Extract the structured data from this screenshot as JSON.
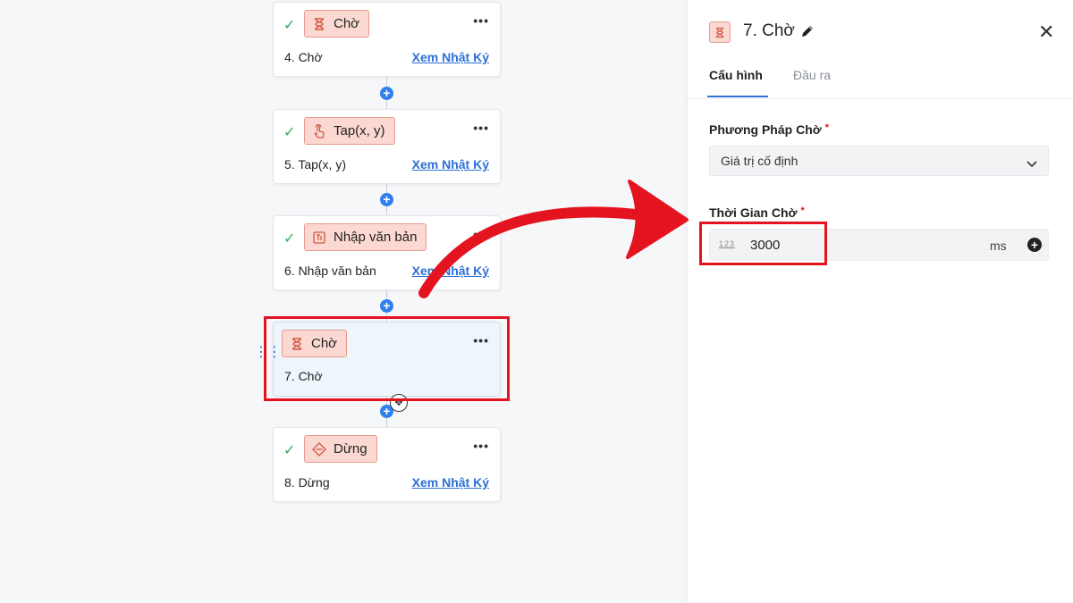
{
  "workflow": {
    "cards": [
      {
        "pill_label": "Chờ",
        "icon": "hourglass-icon",
        "step_label": "4. Chờ",
        "log_link": "Xem Nhật Ký",
        "completed": true
      },
      {
        "pill_label": "Tap(x, y)",
        "icon": "tap-hand-icon",
        "step_label": "5. Tap(x, y)",
        "log_link": "Xem Nhật Ký",
        "completed": true
      },
      {
        "pill_label": "Nhập văn bản",
        "icon": "text-input-icon",
        "step_label": "6. Nhập văn bản",
        "log_link": "Xem Nhật Ký",
        "completed": true
      },
      {
        "pill_label": "Chờ",
        "icon": "hourglass-icon",
        "step_label": "7. Chờ",
        "selected": true
      },
      {
        "pill_label": "Dừng",
        "icon": "stop-diamond-icon",
        "step_label": "8. Dừng",
        "log_link": "Xem Nhật Ký",
        "completed": true
      }
    ],
    "more_label": "•••",
    "add_step_symbol": "+"
  },
  "panel": {
    "title": "7. Chờ",
    "tabs": [
      {
        "label": "Cấu hình",
        "active": true
      },
      {
        "label": "Đầu ra",
        "active": false
      }
    ],
    "wait_method": {
      "label": "Phương Pháp Chờ",
      "required_mark": "*",
      "value": "Giá trị cố định"
    },
    "wait_time": {
      "label": "Thời Gian Chờ",
      "required_mark": "*",
      "type_icon_text": "123",
      "value": "3000",
      "unit": "ms"
    }
  },
  "colors": {
    "pill_bg": "#fbd9d2",
    "pill_border": "#e79a8e",
    "accent_blue": "#2f6fd6",
    "highlight_red": "#e3141f",
    "check_green": "#3aa757"
  }
}
